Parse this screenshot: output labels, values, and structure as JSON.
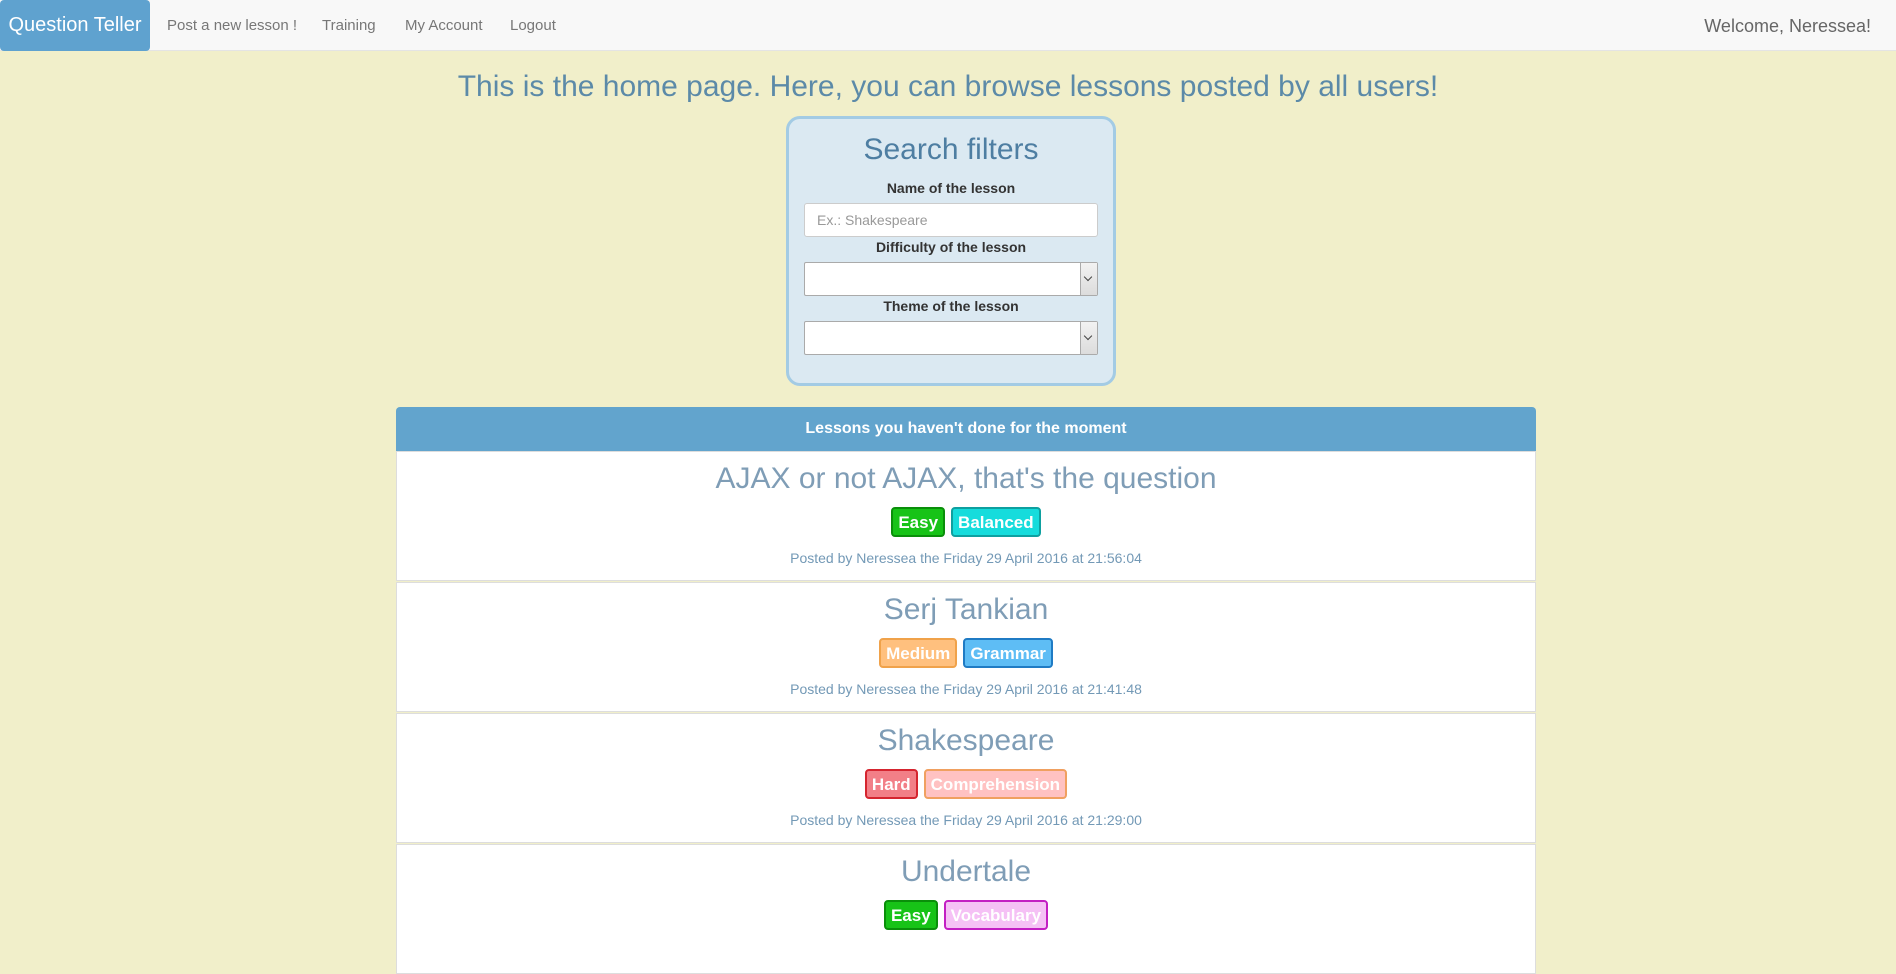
{
  "navbar": {
    "brand": "Question Teller",
    "links": [
      "Post a new lesson !",
      "Training",
      "My Account",
      "Logout"
    ],
    "welcome": "Welcome, Neressea!"
  },
  "page": {
    "title": "This is the home page. Here, you can browse lessons posted by all users!"
  },
  "filters": {
    "title": "Search filters",
    "name_label": "Name of the lesson",
    "name_placeholder": "Ex.: Shakespeare",
    "difficulty_label": "Difficulty of the lesson",
    "difficulty_value": "",
    "theme_label": "Theme of the lesson",
    "theme_value": ""
  },
  "lessons": {
    "heading": "Lessons you haven't done for the moment",
    "items": [
      {
        "title": "AJAX or not AJAX, that's the question",
        "difficulty": "Easy",
        "theme": "Balanced",
        "posted": "Posted by Neressea the Friday 29 April 2016 at 21:56:04"
      },
      {
        "title": "Serj Tankian",
        "difficulty": "Medium",
        "theme": "Grammar",
        "posted": "Posted by Neressea the Friday 29 April 2016 at 21:41:48"
      },
      {
        "title": "Shakespeare",
        "difficulty": "Hard",
        "theme": "Comprehension",
        "posted": "Posted by Neressea the Friday 29 April 2016 at 21:29:00"
      },
      {
        "title": "Undertale",
        "difficulty": "Easy",
        "theme": "Vocabulary",
        "posted": ""
      }
    ]
  },
  "colors": {
    "page_background": "#f1efca",
    "brand": "#5fa2cf",
    "panel_heading": "#62a4cd",
    "tag_easy": "#17c317",
    "tag_medium": "#ffc07e",
    "tag_hard": "#f27f87",
    "tag_balanced": "#16dcdc",
    "tag_grammar": "#5ebdf5",
    "tag_comprehension": "#ffc2c2",
    "tag_vocabulary": "#f5c1f5"
  }
}
